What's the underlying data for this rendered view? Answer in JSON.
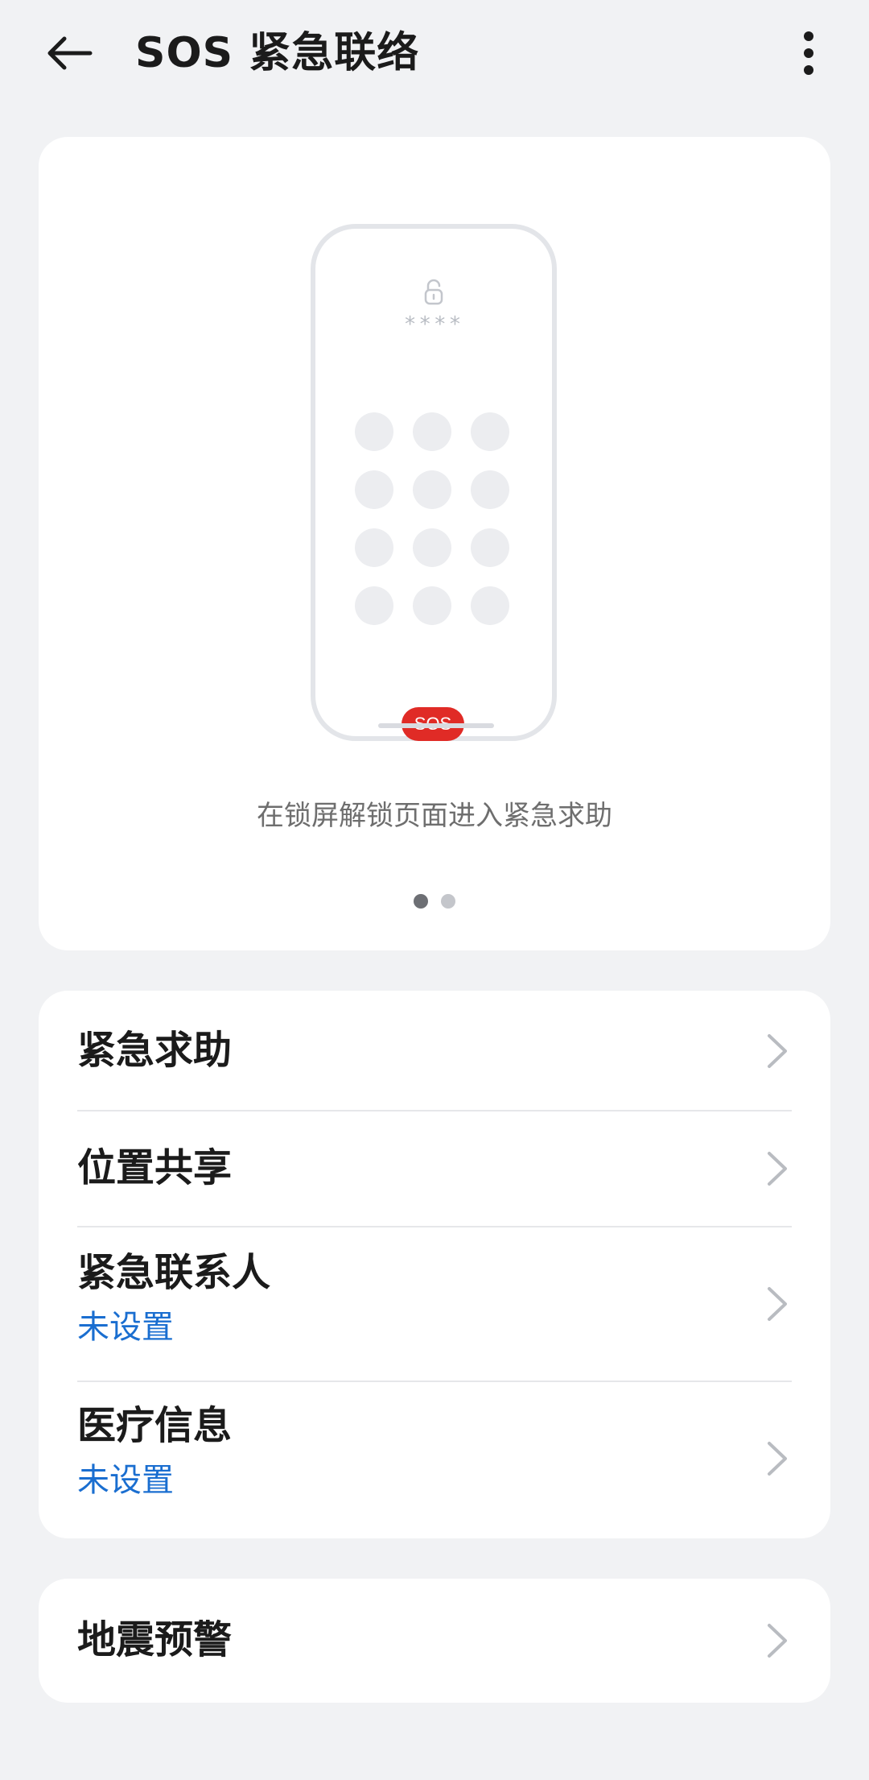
{
  "header": {
    "title": "SOS 紧急联络",
    "back_icon": "arrow-left-icon",
    "more_icon": "more-vertical-icon"
  },
  "hero": {
    "pin_mask": "****",
    "sos_label": "SOS",
    "caption": "在锁屏解锁页面进入紧急求助",
    "page_count": 2,
    "active_page": 1,
    "sos_color": "#e02b26"
  },
  "menu": {
    "items": [
      {
        "title": "紧急求助",
        "subtitle": ""
      },
      {
        "title": "位置共享",
        "subtitle": ""
      },
      {
        "title": "紧急联系人",
        "subtitle": "未设置"
      },
      {
        "title": "医疗信息",
        "subtitle": "未设置"
      }
    ]
  },
  "quake": {
    "title": "地震预警"
  },
  "colors": {
    "accent_link": "#1a6ed0",
    "background": "#f1f2f4"
  }
}
